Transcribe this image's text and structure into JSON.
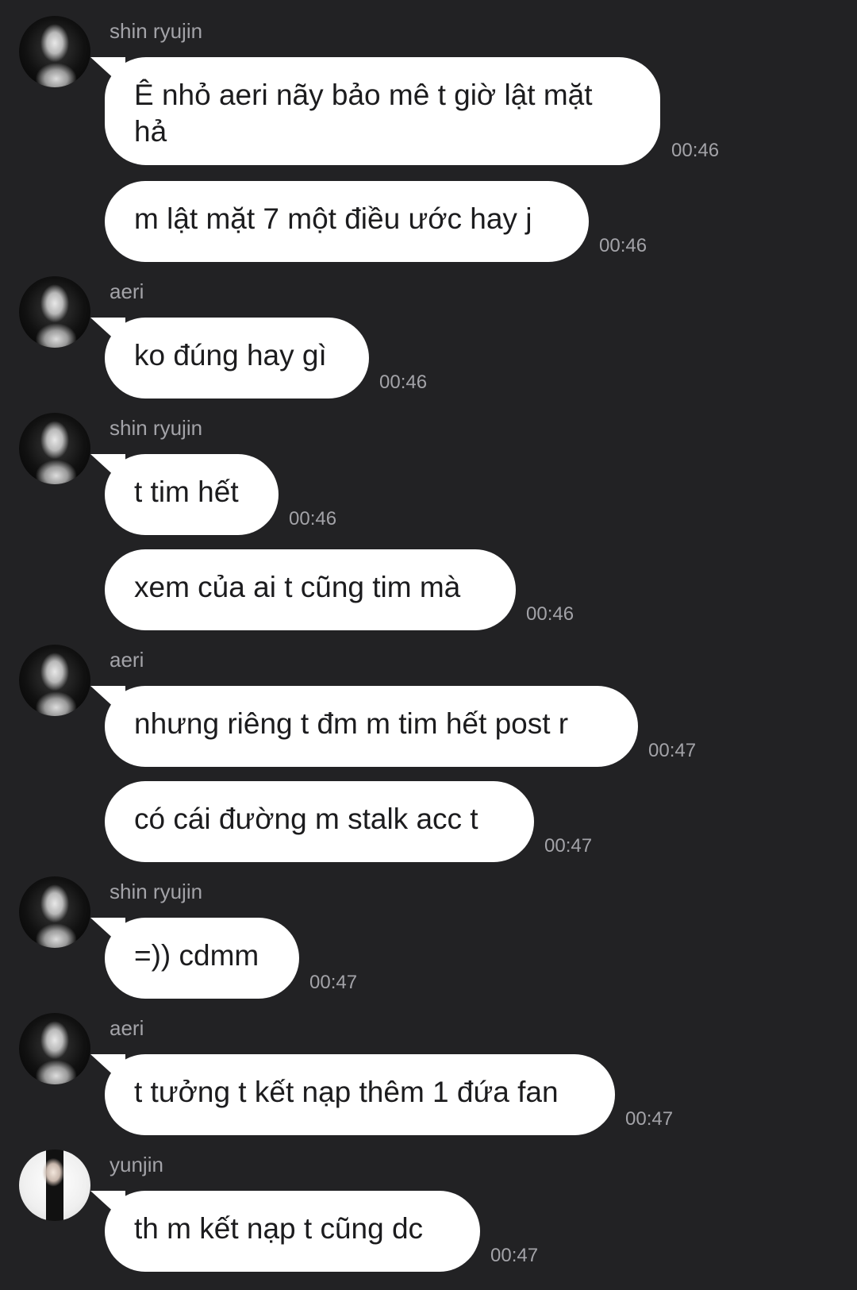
{
  "messages": [
    {
      "sender": "shin ryujin",
      "text": "Ê nhỏ aeri nãy bảo mê t giờ lật mặt hả",
      "time": "00:46"
    },
    {
      "sender": "",
      "text": "m lật mặt 7 một điều ước hay j",
      "time": "00:46"
    },
    {
      "sender": "aeri",
      "text": "ko đúng hay gì",
      "time": "00:46"
    },
    {
      "sender": "shin ryujin",
      "text": "t tim hết",
      "time": "00:46"
    },
    {
      "sender": "",
      "text": "xem của ai t cũng tim mà",
      "time": "00:46"
    },
    {
      "sender": "aeri",
      "text": "nhưng riêng t đm m tim hết post r",
      "time": "00:47"
    },
    {
      "sender": "",
      "text": "có cái đường m stalk acc t",
      "time": "00:47"
    },
    {
      "sender": "shin ryujin",
      "text": "=)) cdmm",
      "time": "00:47"
    },
    {
      "sender": "aeri",
      "text": "t tưởng t kết nạp thêm 1 đứa fan",
      "time": "00:47"
    },
    {
      "sender": "yunjin",
      "text": "th m kết nạp t cũng dc",
      "time": "00:47"
    }
  ]
}
